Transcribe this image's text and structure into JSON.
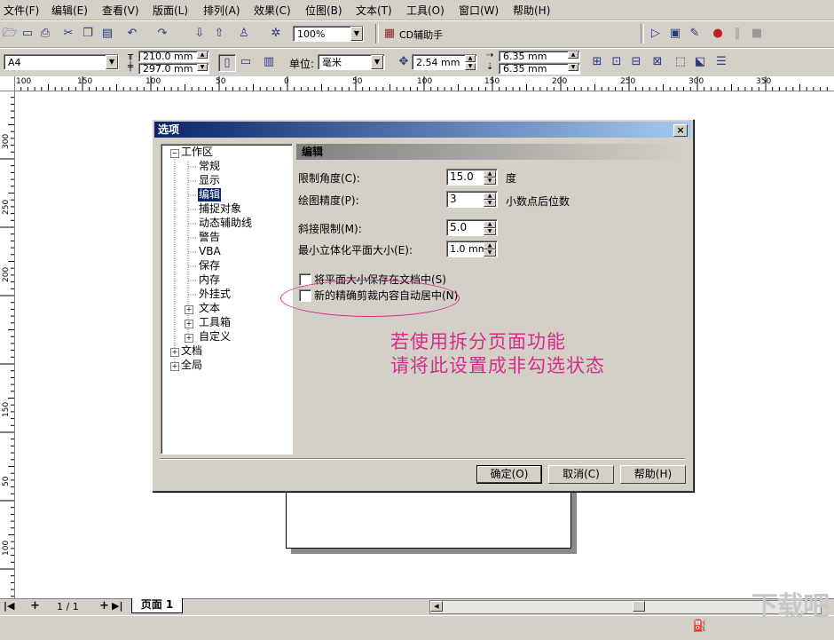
{
  "menu": [
    "文件(F)",
    "编辑(E)",
    "查看(V)",
    "版面(L)",
    "排列(A)",
    "效果(C)",
    "位图(B)",
    "文本(T)",
    "工具(O)",
    "窗口(W)",
    "帮助(H)"
  ],
  "toolbar1": {
    "zoom": "100%",
    "helper_label": "CD辅助手"
  },
  "toolbar2": {
    "paper_size": "A4",
    "width": "210.0 mm",
    "height": "297.0 mm",
    "unit_label": "单位:",
    "unit": "毫米",
    "nudge": "2.54 mm",
    "dup_x": "6.35 mm",
    "dup_y": "6.35 mm"
  },
  "ruler": {
    "h": [
      "100",
      "150",
      "100",
      "50",
      "0",
      "50",
      "100",
      "150",
      "200",
      "250",
      "300",
      "350"
    ],
    "v": [
      "300",
      "250",
      "200",
      "150",
      "100",
      "50"
    ]
  },
  "dialog": {
    "title": "选项",
    "close": "×",
    "section_title": "编辑",
    "tree": [
      {
        "label": "工作区",
        "expand": "−",
        "level": 0
      },
      {
        "label": "常规",
        "level": 1
      },
      {
        "label": "显示",
        "level": 1
      },
      {
        "label": "编辑",
        "level": 1,
        "selected": true
      },
      {
        "label": "捕捉对象",
        "level": 1
      },
      {
        "label": "动态辅助线",
        "level": 1
      },
      {
        "label": "警告",
        "level": 1
      },
      {
        "label": "VBA",
        "level": 1
      },
      {
        "label": "保存",
        "level": 1
      },
      {
        "label": "内存",
        "level": 1
      },
      {
        "label": "外挂式",
        "level": 1
      },
      {
        "label": "文本",
        "expand": "+",
        "level": 1
      },
      {
        "label": "工具箱",
        "expand": "+",
        "level": 1
      },
      {
        "label": "自定义",
        "expand": "+",
        "level": 1
      },
      {
        "label": "文档",
        "expand": "+",
        "level": 0
      },
      {
        "label": "全局",
        "expand": "+",
        "level": 0
      }
    ],
    "fields": {
      "constrain_label": "限制角度(C):",
      "constrain_value": "15.0",
      "constrain_unit": "度",
      "precision_label": "绘图精度(P):",
      "precision_value": "3",
      "precision_unit": "小数点后位数",
      "miter_label": "斜接限制(M):",
      "miter_value": "5.0",
      "min_extrude_label": "最小立体化平面大小(E):",
      "min_extrude_value": "1.0 mm"
    },
    "checkboxes": [
      {
        "label": "将平面大小保存在文档中(S)",
        "checked": false
      },
      {
        "label": "新的精确剪裁内容自动居中(N)",
        "checked": false
      }
    ],
    "buttons": {
      "ok": "确定(O)",
      "cancel": "取消(C)",
      "help": "帮助(H)"
    }
  },
  "annotation": [
    "若使用拆分页面功能",
    "请将此设置成非勾选状态"
  ],
  "pagebar": {
    "counter": "1 / 1",
    "tab": "页面 1"
  },
  "watermark": "下载吧",
  "colors": {
    "accent": "#d0308a",
    "titlebar": "#0a246a"
  }
}
